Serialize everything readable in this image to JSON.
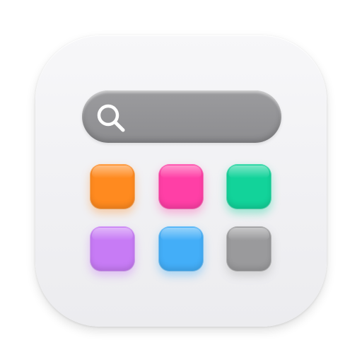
{
  "app_icon": {
    "background": "#f2f2f4",
    "search_bar": {
      "color": "#929295",
      "icon": "search-icon",
      "icon_color": "#ffffff"
    },
    "tiles": [
      {
        "name": "orange-tile",
        "color": "#ff8a1f",
        "glow": "rgba(255,138,31,0.35)"
      },
      {
        "name": "pink-tile",
        "color": "#ff3fa6",
        "glow": "rgba(255,63,166,0.35)"
      },
      {
        "name": "green-tile",
        "color": "#12d39a",
        "glow": "rgba(18,211,154,0.40)"
      },
      {
        "name": "purple-tile",
        "color": "#c77bf5",
        "glow": "rgba(199,123,245,0.40)"
      },
      {
        "name": "blue-tile",
        "color": "#43aef8",
        "glow": "rgba(67,174,248,0.40)"
      },
      {
        "name": "gray-tile",
        "color": "#9a9a9c",
        "glow": "rgba(120,120,120,0.25)"
      }
    ]
  }
}
